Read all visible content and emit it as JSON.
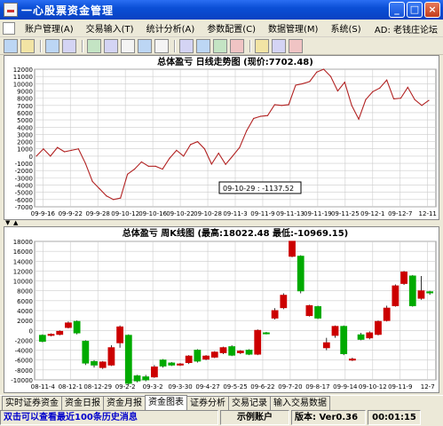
{
  "window": {
    "title": "一心股票资金管理",
    "buttons": [
      "_",
      "□",
      "×"
    ]
  },
  "menu": {
    "items": [
      "账户管理(A)",
      "交易输入(T)",
      "统计分析(A)",
      "参数配置(C)",
      "数据管理(M)",
      "系统(S)"
    ],
    "ad": "AD: 老钱庄论坛"
  },
  "toolbar": {
    "icons": [
      "import-icon",
      "settings-icon",
      "report-icon",
      "copy-icon",
      "chart-icon",
      "globe-icon",
      "filter-icon",
      "grid-icon",
      "document-icon",
      "export-icon",
      "print-icon",
      "refresh-icon",
      "save-icon",
      "help-icon",
      "tools-icon",
      "exit-icon"
    ]
  },
  "top_chart": {
    "title": "总体盈亏  日线走势图  (现价:7702.48)",
    "tooltip": "09-10-29 : -1137.52"
  },
  "bottom_chart": {
    "title": "总体盈亏  周K线图  (最高:18022.48  最低:-10969.15)"
  },
  "chart_data": [
    {
      "type": "line",
      "title": "总体盈亏  日线走势图  (现价:7702.48)",
      "ylim": [
        -7000,
        12000
      ],
      "yticks": [
        12000,
        11000,
        10000,
        9000,
        8000,
        7000,
        6000,
        5000,
        4000,
        3000,
        2000,
        1000,
        0,
        -1000,
        -2000,
        -3000,
        -4000,
        -5000,
        -6000,
        -7000
      ],
      "x_labels": [
        "09-9-16",
        "09-9-22",
        "09-9-28",
        "09-10-12",
        "09-10-16",
        "09-10-22",
        "09-10-28",
        "09-11-3",
        "09-11-9",
        "09-11-13",
        "09-11-19",
        "09-11-25",
        "09-12-1",
        "09-12-7",
        "12-11"
      ],
      "series": [
        {
          "color": "#b22222",
          "values": [
            0,
            1000,
            0,
            1200,
            600,
            800,
            1000,
            -1000,
            -3500,
            -4500,
            -5500,
            -6000,
            -5800,
            -2500,
            -1800,
            -800,
            -1400,
            -1400,
            -1800,
            -300,
            800,
            0,
            1600,
            2000,
            1000,
            -1100,
            400,
            -1137.52,
            0,
            1200,
            3500,
            5200,
            5500,
            5600,
            7100,
            7000,
            7100,
            9800,
            10000,
            10300,
            11600,
            12000,
            11000,
            9000,
            10200,
            7000,
            5100,
            7800,
            8900,
            9400,
            10500,
            7900,
            8000,
            9500,
            7800,
            7000,
            7700
          ]
        }
      ]
    },
    {
      "type": "candlestick",
      "title": "总体盈亏  周K线图  (最高:18022.48  最低:-10969.15)",
      "ylim": [
        -10000,
        18000
      ],
      "yticks": [
        18000,
        16000,
        14000,
        12000,
        10000,
        8000,
        6000,
        4000,
        2000,
        0,
        -2000,
        -4000,
        -6000,
        -8000,
        -10000
      ],
      "x_labels": [
        "08-11-4",
        "08-12-1",
        "08-12-29",
        "09-2-2",
        "09-3-2",
        "09-3-30",
        "09-4-27",
        "09-5-25",
        "09-6-22",
        "09-7-20",
        "09-8-17",
        "09-9-14",
        "09-10-12",
        "09-11-9",
        "12-7"
      ],
      "max": 18022.48,
      "min": -10969.15,
      "candles": [
        {
          "o": -1000,
          "c": -2200,
          "h": -800,
          "l": -2400
        },
        {
          "o": -1000,
          "c": -800,
          "h": -600,
          "l": -1200
        },
        {
          "o": -800,
          "c": -200,
          "h": 0,
          "l": -1000
        },
        {
          "o": 600,
          "c": 1500,
          "h": 1800,
          "l": 400
        },
        {
          "o": 1800,
          "c": -500,
          "h": 2000,
          "l": -800
        },
        {
          "o": -2200,
          "c": -6600,
          "h": -2000,
          "l": -7000
        },
        {
          "o": -6300,
          "c": -7000,
          "h": -6000,
          "l": -7500
        },
        {
          "o": -7500,
          "c": -6400,
          "h": -6200,
          "l": -7800
        },
        {
          "o": -7000,
          "c": -3500,
          "h": -3000,
          "l": -7200
        },
        {
          "o": -2500,
          "c": 700,
          "h": 1000,
          "l": -3500
        },
        {
          "o": -1000,
          "c": -10700,
          "h": -800,
          "l": -11000
        },
        {
          "o": -9200,
          "c": -10200,
          "h": -9000,
          "l": -10500
        },
        {
          "o": -9400,
          "c": -10000,
          "h": -9000,
          "l": -10300
        },
        {
          "o": -9400,
          "c": -7400,
          "h": -7000,
          "l": -9600
        },
        {
          "o": -6000,
          "c": -7200,
          "h": -5800,
          "l": -7500
        },
        {
          "o": -6600,
          "c": -7000,
          "h": -6400,
          "l": -7200
        },
        {
          "o": -7000,
          "c": -6800,
          "h": -6600,
          "l": -7200
        },
        {
          "o": -6500,
          "c": -5200,
          "h": -5000,
          "l": -6800
        },
        {
          "o": -4000,
          "c": -6200,
          "h": -3800,
          "l": -6500
        },
        {
          "o": -5800,
          "c": -5200,
          "h": -5000,
          "l": -6000
        },
        {
          "o": -5400,
          "c": -4400,
          "h": -4200,
          "l": -5600
        },
        {
          "o": -4500,
          "c": -3500,
          "h": -3300,
          "l": -4800
        },
        {
          "o": -3300,
          "c": -5000,
          "h": -3000,
          "l": -5200
        },
        {
          "o": -4500,
          "c": -4200,
          "h": -4000,
          "l": -4800
        },
        {
          "o": -4000,
          "c": -4800,
          "h": -3800,
          "l": -5000
        },
        {
          "o": -4800,
          "c": 0,
          "h": 200,
          "l": -5000
        },
        {
          "o": -500,
          "c": -600,
          "h": -300,
          "l": -800
        },
        {
          "o": 2500,
          "c": 4000,
          "h": 4500,
          "l": 2200
        },
        {
          "o": 4600,
          "c": 7100,
          "h": 7500,
          "l": 4300
        },
        {
          "o": 15000,
          "c": 18022.48,
          "h": 18022.48,
          "l": 14800
        },
        {
          "o": 15000,
          "c": 8000,
          "h": 15200,
          "l": 7500
        },
        {
          "o": 3000,
          "c": 5000,
          "h": 5200,
          "l": 2800
        },
        {
          "o": 4800,
          "c": 2500,
          "h": 5000,
          "l": 2300
        },
        {
          "o": -3500,
          "c": -2500,
          "h": -1500,
          "l": -4000
        },
        {
          "o": -1000,
          "c": 800,
          "h": 1000,
          "l": -1500
        },
        {
          "o": 800,
          "c": -4700,
          "h": 1000,
          "l": -5000
        },
        {
          "o": -6000,
          "c": -5800,
          "h": -5500,
          "l": -6200
        },
        {
          "o": -900,
          "c": -1800,
          "h": -500,
          "l": -2000
        },
        {
          "o": -1500,
          "c": -500,
          "h": -200,
          "l": -1800
        },
        {
          "o": -800,
          "c": 1800,
          "h": 2000,
          "l": -1000
        },
        {
          "o": 2000,
          "c": 4500,
          "h": 5000,
          "l": 1800
        },
        {
          "o": 5000,
          "c": 9000,
          "h": 9300,
          "l": 4800
        },
        {
          "o": 9500,
          "c": 11800,
          "h": 12000,
          "l": 9200
        },
        {
          "o": 11000,
          "c": 5000,
          "h": 11200,
          "l": 4800
        },
        {
          "o": 6500,
          "c": 8000,
          "h": 11000,
          "l": 6200
        },
        {
          "o": 7800,
          "c": 7600,
          "h": 8000,
          "l": 7200
        }
      ]
    }
  ],
  "tabs": [
    {
      "label": "实时证券资金",
      "active": false
    },
    {
      "label": "资金日报",
      "active": false
    },
    {
      "label": "资金月报",
      "active": false
    },
    {
      "label": "资金图表",
      "active": true
    },
    {
      "label": "证券分析",
      "active": false
    },
    {
      "label": "交易记录",
      "active": false
    },
    {
      "label": "输入交易数据",
      "active": false
    }
  ],
  "status": {
    "message": "双击可以查看最近100条历史消息",
    "account": "示例账户",
    "version": "版本: Ver0.36",
    "time": "00:01:15"
  },
  "colors": {
    "line": "#b22222",
    "up": "#cc0000",
    "down": "#00aa00",
    "grid": "#cccccc"
  }
}
